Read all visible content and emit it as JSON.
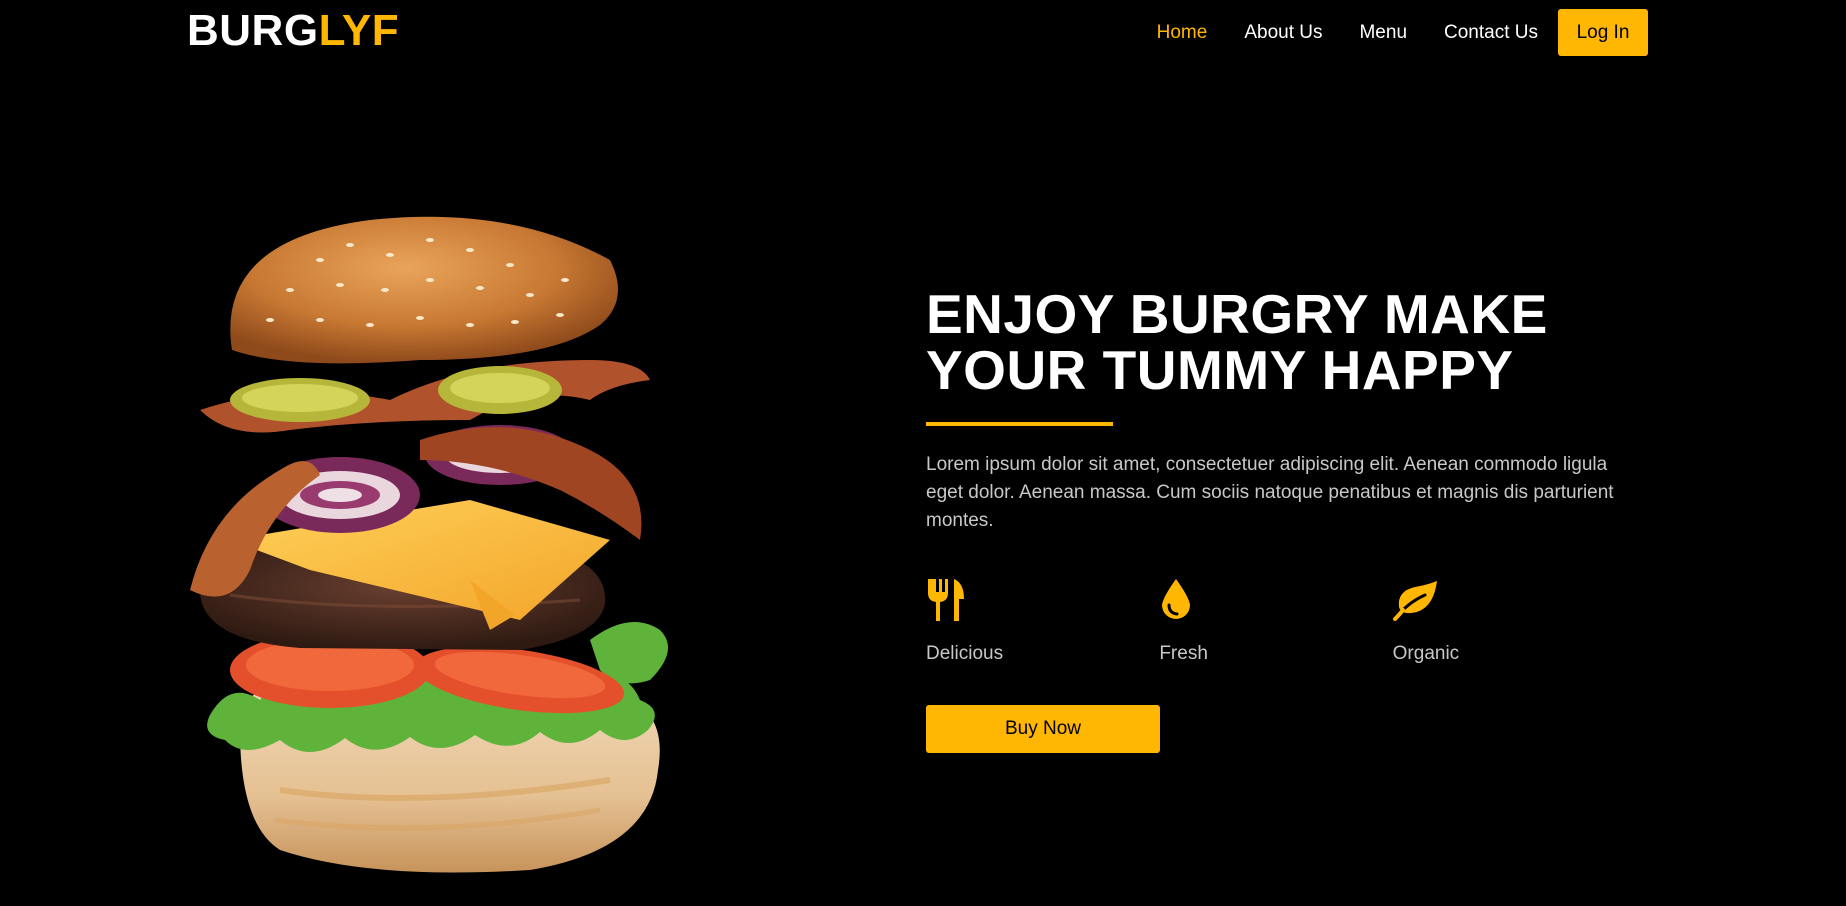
{
  "brand": {
    "part1": "BURG",
    "part2": "LYF"
  },
  "nav": {
    "links": [
      {
        "label": "Home",
        "active": true
      },
      {
        "label": "About Us"
      },
      {
        "label": "Menu"
      },
      {
        "label": "Contact Us"
      }
    ],
    "login_label": "Log In"
  },
  "hero": {
    "title_line1": "ENJOY BURGRY MAKE",
    "title_line2": "YOUR TUMMY HAPPY",
    "description": "Lorem ipsum dolor sit amet, consectetuer adipiscing elit. Aenean commodo ligula eget dolor. Aenean massa. Cum sociis natoque penatibus et magnis dis parturient montes.",
    "features": [
      {
        "label": "Delicious",
        "icon": "utensils-icon"
      },
      {
        "label": "Fresh",
        "icon": "droplet-icon"
      },
      {
        "label": "Organic",
        "icon": "leaf-icon"
      }
    ],
    "buy_label": "Buy Now"
  },
  "colors": {
    "accent": "#ffb703",
    "background": "#000000",
    "muted_text": "#c8c8c8"
  }
}
